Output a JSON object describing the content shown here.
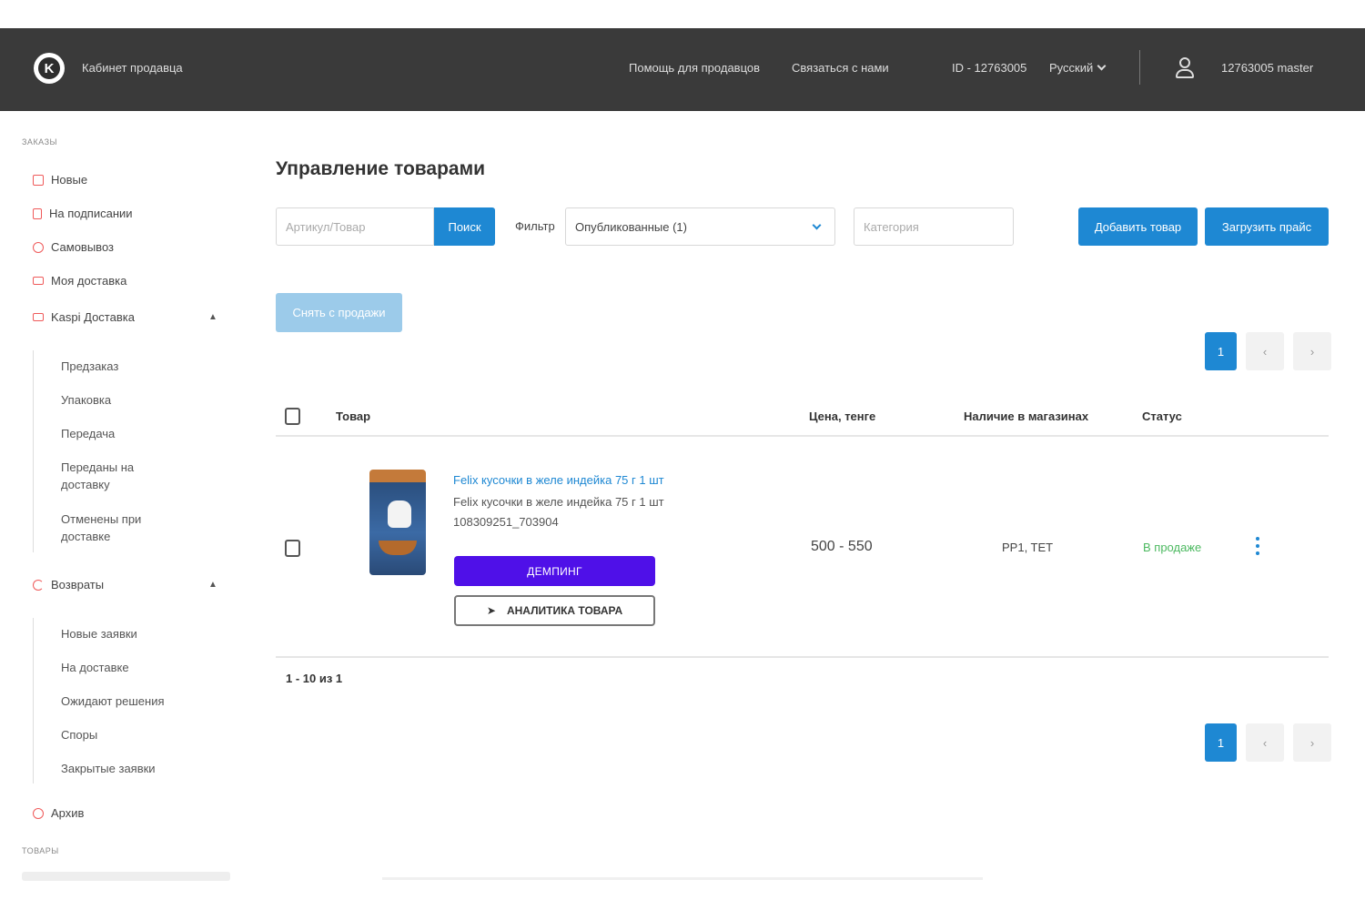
{
  "header": {
    "brand": "Кабинет продавца",
    "links": [
      "Помощь для продавцов",
      "Связаться с нами"
    ],
    "seller_id": "ID - 12763005",
    "language": "Русский",
    "username": "12763005 master"
  },
  "sidebar": {
    "section_orders": "ЗАКАЗЫ",
    "items": {
      "new": "Новые",
      "signing": "На подписании",
      "pickup": "Самовывоз",
      "my_delivery": "Моя доставка",
      "kaspi_delivery": "Kaspi Доставка",
      "returns": "Возвраты",
      "archive": "Архив"
    },
    "kaspi_sub": [
      "Предзаказ",
      "Упаковка",
      "Передача",
      "Переданы на доставку",
      "Отменены при доставке"
    ],
    "returns_sub": [
      "Новые заявки",
      "На доставке",
      "Ожидают решения",
      "Споры",
      "Закрытые заявки"
    ],
    "section_goods": "ТОВАРЫ"
  },
  "main": {
    "title": "Управление товарами",
    "search_placeholder": "Артикул/Товар",
    "search_button": "Поиск",
    "filter_label": "Фильтр",
    "filter_value": "Опубликованные (1)",
    "category_placeholder": "Категория",
    "add_button": "Добавить товар",
    "upload_button": "Загрузить прайс",
    "remove_button": "Снять с продажи",
    "pagination": {
      "current": "1",
      "prev": "‹",
      "next": "›"
    },
    "table": {
      "headers": {
        "product": "Товар",
        "price": "Цена, тенге",
        "availability": "Наличие в магазинах",
        "status": "Статус"
      },
      "rows": [
        {
          "title": "Felix кусочки в желе индейка 75 г 1 шт",
          "subtitle": "Felix кусочки в желе индейка 75 г 1 шт",
          "sku": "108309251_703904",
          "dumping_button": "ДЕМПИНГ",
          "analytics_button": "АНАЛИТИКА ТОВАРА",
          "price": "500 - 550",
          "stores": "PP1, TET",
          "status": "В продаже"
        }
      ]
    },
    "count_text": "1 - 10 из 1"
  }
}
